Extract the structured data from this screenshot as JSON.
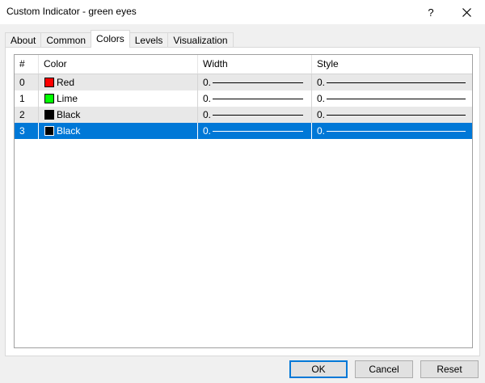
{
  "window": {
    "title": "Custom Indicator - green eyes",
    "help_label": "?",
    "close_label": "✕"
  },
  "tabs": [
    {
      "label": "About"
    },
    {
      "label": "Common"
    },
    {
      "label": "Colors",
      "active": true
    },
    {
      "label": "Levels"
    },
    {
      "label": "Visualization"
    }
  ],
  "table": {
    "headers": {
      "index": "#",
      "color": "Color",
      "width": "Width",
      "style": "Style"
    },
    "rows": [
      {
        "index": "0",
        "color": "Red",
        "swatch": "#ff0000",
        "width": "0.",
        "style": "0."
      },
      {
        "index": "1",
        "color": "Lime",
        "swatch": "#00ff00",
        "width": "0.",
        "style": "0."
      },
      {
        "index": "2",
        "color": "Black",
        "swatch": "#000000",
        "width": "0.",
        "style": "0."
      },
      {
        "index": "3",
        "color": "Black",
        "swatch": "#000000",
        "width": "0.",
        "style": "0.",
        "selected": true
      }
    ]
  },
  "buttons": {
    "ok": "OK",
    "cancel": "Cancel",
    "reset": "Reset"
  },
  "colors": {
    "selection": "#0078d7",
    "alt_row": "#e8e8e8"
  }
}
